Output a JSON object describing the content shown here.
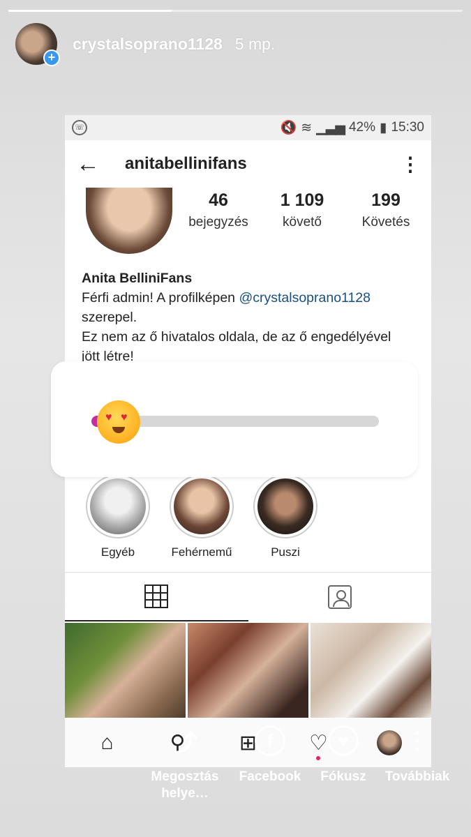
{
  "story": {
    "username": "crystalsoprano1128",
    "time": "5 mp.",
    "progress": 0.36
  },
  "statusbar": {
    "app_icon": "viber-icon",
    "battery": "42%",
    "time": "15:30"
  },
  "profile": {
    "username": "anitabellinifans",
    "stats": [
      {
        "num": "46",
        "label": "bejegyzés"
      },
      {
        "num": "1 109",
        "label": "követő"
      },
      {
        "num": "199",
        "label": "Követés"
      }
    ],
    "name": "Anita BelliniFans",
    "bio_line1_pre": "Férfi admin! A profilképen ",
    "bio_mention": "@crystalsoprano1128",
    "bio_line2": "szerepel.",
    "bio_line3": "Ez nem az ő hivatalos oldala, de az ő engedélyével",
    "bio_line4": "jött létre!"
  },
  "highlights": [
    {
      "label": "Egyéb"
    },
    {
      "label": "Fehérnemű"
    },
    {
      "label": "Puszi"
    }
  ],
  "slider": {
    "emoji": "heart-eyes-emoji",
    "value": 0.02,
    "fill_color": "#c42fa0"
  },
  "actions": [
    {
      "label_line1": "Megosztás",
      "label_line2": "helye…",
      "icon": "share-icon"
    },
    {
      "label_line1": "Facebook",
      "label_line2": "",
      "icon": "facebook-icon"
    },
    {
      "label_line1": "Fókusz",
      "label_line2": "",
      "icon": "heart-icon"
    },
    {
      "label_line1": "Továbbiak",
      "label_line2": "",
      "icon": "more-icon"
    }
  ]
}
